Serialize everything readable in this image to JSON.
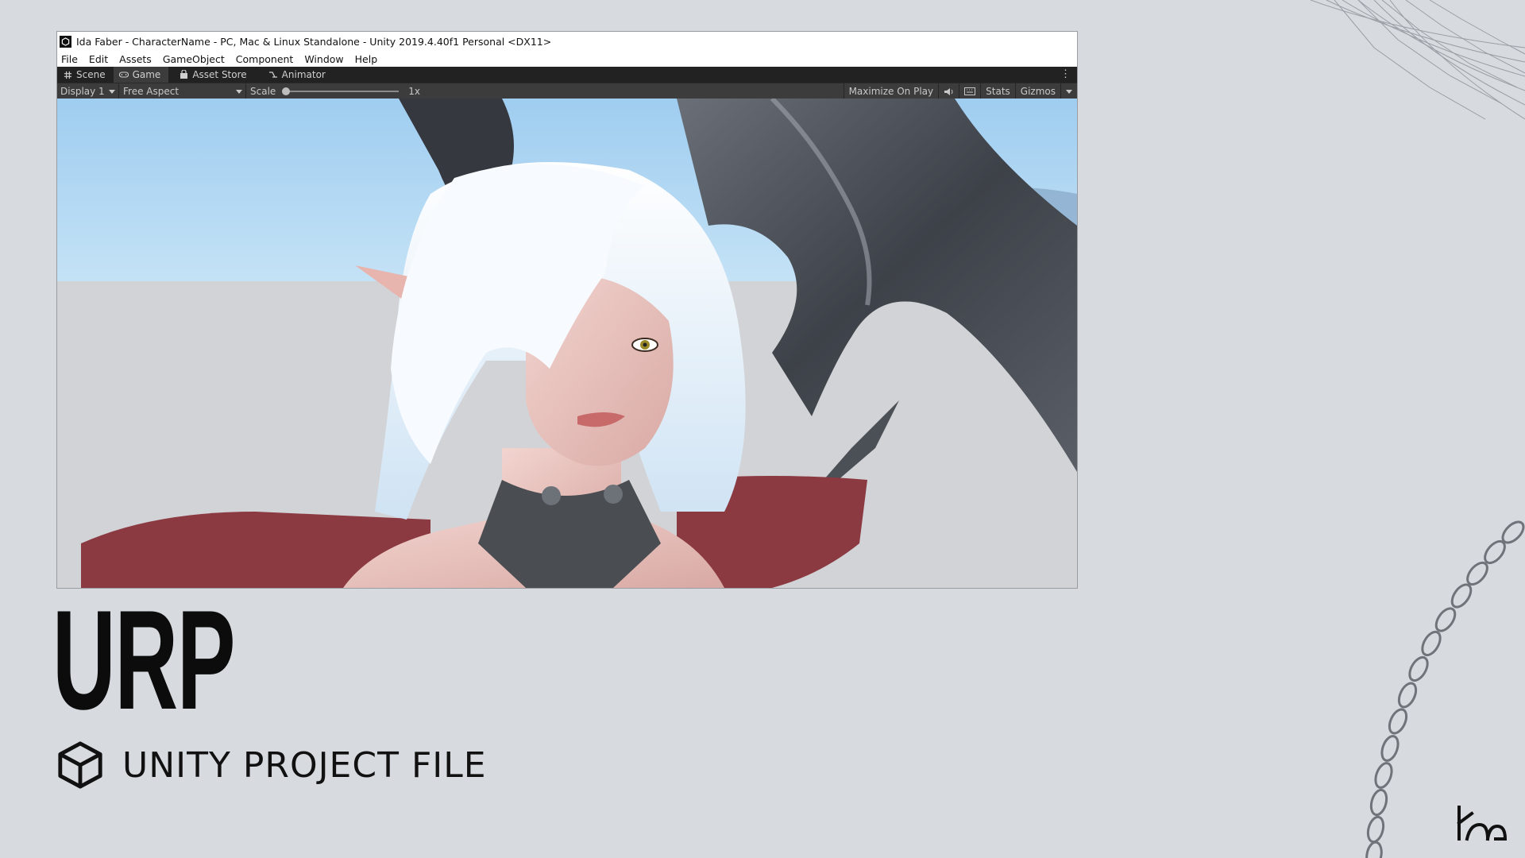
{
  "window": {
    "title": "Ida Faber - CharacterName - PC, Mac & Linux Standalone - Unity 2019.4.40f1 Personal <DX11>"
  },
  "menu": [
    "File",
    "Edit",
    "Assets",
    "GameObject",
    "Component",
    "Window",
    "Help"
  ],
  "tabs": [
    {
      "label": "Scene",
      "icon": "hash-icon"
    },
    {
      "label": "Game",
      "icon": "gamepad-icon"
    },
    {
      "label": "Asset Store",
      "icon": "bag-icon"
    },
    {
      "label": "Animator",
      "icon": "animator-icon"
    }
  ],
  "toolbar": {
    "display": "Display 1",
    "aspect": "Free Aspect",
    "scale_label": "Scale",
    "scale_value": "1x",
    "maximize": "Maximize On Play",
    "stats": "Stats",
    "gizmos": "Gizmos"
  },
  "caption": {
    "headline": "URP",
    "subtitle": "UNITY PROJECT FILE"
  },
  "colors": {
    "background": "#d7dadf",
    "unity_dark": "#222222",
    "unity_toolbar": "#3c3c3c",
    "sky": "#a9d2ef"
  }
}
